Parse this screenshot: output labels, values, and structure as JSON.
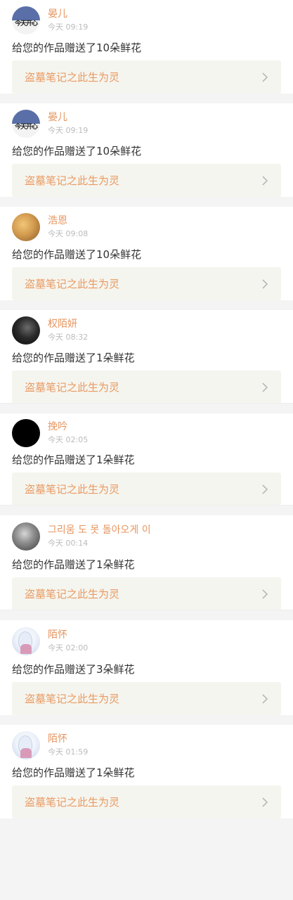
{
  "work_title": "盗墓笔记之此生为灵",
  "colors": {
    "name": "#e6955f",
    "time": "#bbbbbb",
    "message": "#333333",
    "work_title": "#e89a63",
    "work_bg": "#f5f5ef",
    "page_bg": "#f4f4f4"
  },
  "notifications": [
    {
      "name": "晏儿",
      "time": "今天 09:19",
      "message": "给您的作品赠送了10朵鲜花",
      "avatar": "avatar-jintian",
      "avatar_text": "今天开心"
    },
    {
      "name": "晏儿",
      "time": "今天 09:19",
      "message": "给您的作品赠送了10朵鲜花",
      "avatar": "avatar-jintian",
      "avatar_text": "今天开心"
    },
    {
      "name": "浩恩",
      "time": "今天 09:08",
      "message": "给您的作品赠送了10朵鲜花",
      "avatar": "avatar-photo-warm"
    },
    {
      "name": "权陌妍",
      "time": "今天 08:32",
      "message": "给您的作品赠送了1朵鲜花",
      "avatar": "avatar-photo-dark"
    },
    {
      "name": "挽吟",
      "time": "今天 02:05",
      "message": "给您的作品赠送了1朵鲜花",
      "avatar": "avatar-black"
    },
    {
      "name": "그리움 도 못 돌아오게 이",
      "time": "今天 00:14",
      "message": "给您的作品赠送了1朵鲜花",
      "avatar": "avatar-photo-grey"
    },
    {
      "name": "陌怀",
      "time": "今天 02:00",
      "message": "给您的作品赠送了3朵鲜花",
      "avatar": "avatar-anime"
    },
    {
      "name": "陌怀",
      "time": "今天 01:59",
      "message": "给您的作品赠送了1朵鲜花",
      "avatar": "avatar-anime"
    }
  ]
}
